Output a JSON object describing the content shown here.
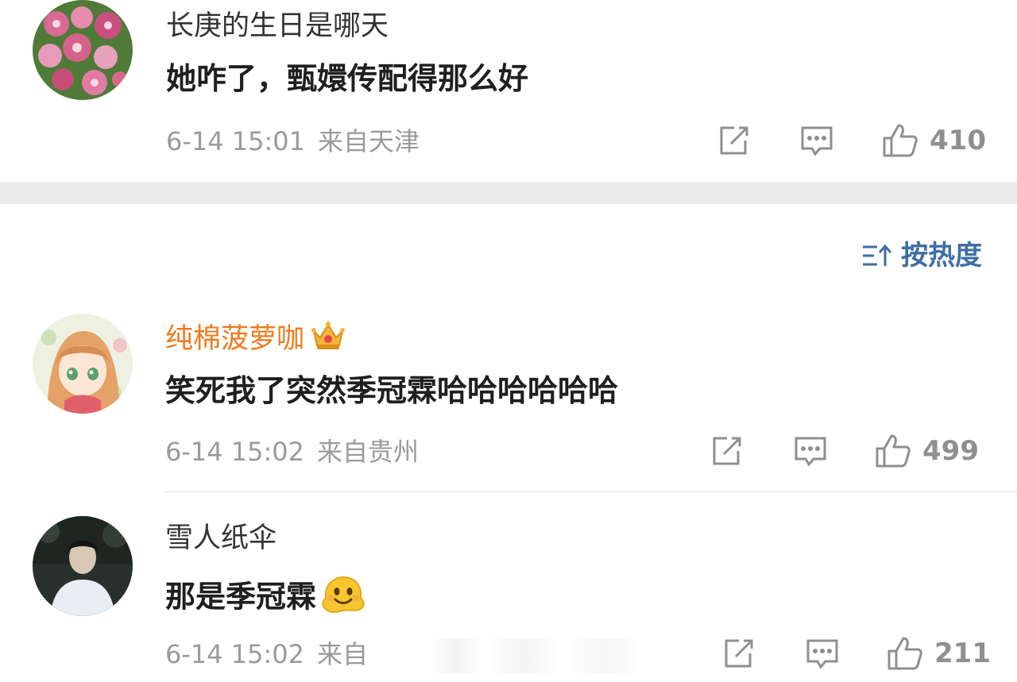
{
  "sort": {
    "label": "按热度"
  },
  "comments": [
    {
      "username": "长庚的生日是哪天",
      "content": "她咋了，甄嬛传配得那么好",
      "time": "6-14 15:01",
      "location": "来自天津",
      "likes": "410"
    },
    {
      "username": "纯棉菠萝咖",
      "content": "笑死我了突然季冠霖哈哈哈哈哈哈",
      "time": "6-14 15:02",
      "location": "来自贵州",
      "likes": "499"
    },
    {
      "username": "雪人纸伞",
      "content": "那是季冠霖",
      "time": "6-14 15:02",
      "location": "来自",
      "likes": "211"
    }
  ],
  "colors": {
    "vip_name": "#f07a1c",
    "sort_link": "#3f6ea3",
    "meta": "#9a9a9a"
  }
}
